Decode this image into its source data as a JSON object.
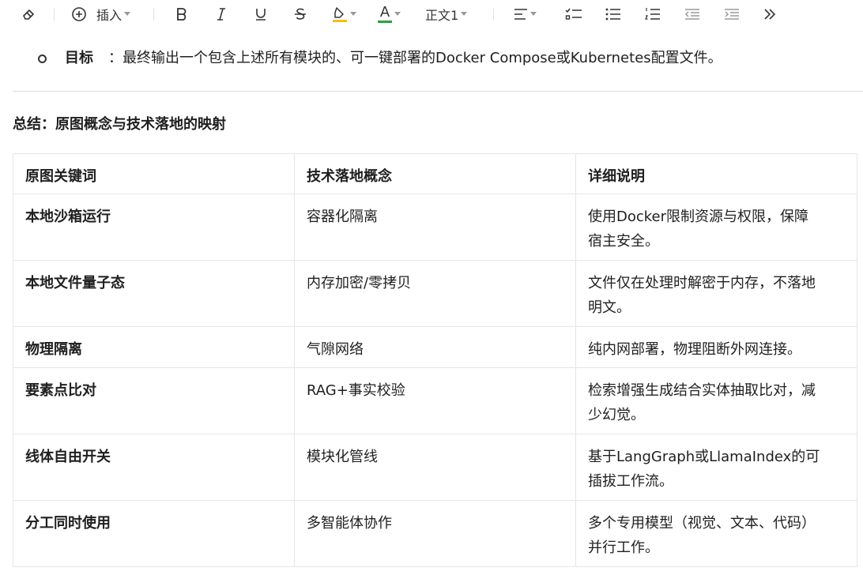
{
  "toolbar": {
    "insert_label": "插入",
    "style_label": "正文1",
    "text_color_letter": "A",
    "accent_highlight": "#f2c200",
    "accent_text_color": "#2f9e44",
    "icons": [
      "eraser-icon",
      "plus-circle-icon",
      "bold-icon",
      "italic-icon",
      "underline-icon",
      "strikethrough-icon",
      "highlighter-icon",
      "text-color-icon",
      "align-left-icon",
      "checklist-icon",
      "bullet-list-icon",
      "numbered-list-icon",
      "outdent-icon",
      "indent-icon",
      "more-icon"
    ]
  },
  "goal": {
    "label": "目标",
    "text": "：最终输出一个包含上述所有模块的、可一键部署的Docker Compose或Kubernetes配置文件。"
  },
  "section_title": "总结：原图概念与技术落地的映射",
  "table": {
    "headers": [
      "原图关键词",
      "技术落地概念",
      "详细说明"
    ],
    "rows": [
      {
        "keyword": "本地沙箱运行",
        "concept": "容器化隔离",
        "detail_line1": "使用Docker限制资源与权限，保障",
        "detail_line2": "宿主安全。"
      },
      {
        "keyword": "本地文件量子态",
        "concept": "内存加密/零拷贝",
        "detail_line1": "文件仅在处理时解密于内存，不落地",
        "detail_line2": "明文。"
      },
      {
        "keyword": "物理隔离",
        "concept": "气隙网络",
        "detail_line1": "纯内网部署，物理阻断外网连接。",
        "detail_line2": ""
      },
      {
        "keyword": "要素点比对",
        "concept": "RAG+事实校验",
        "detail_line1": "检索增强生成结合实体抽取比对，减",
        "detail_line2": "少幻觉。"
      },
      {
        "keyword": "线体自由开关",
        "concept": "模块化管线",
        "detail_line1": "基于LangGraph或LlamaIndex的可",
        "detail_line2": "插拔工作流。"
      },
      {
        "keyword": "分工同时使用",
        "concept": "多智能体协作",
        "detail_line1": "多个专用模型（视觉、文本、代码）",
        "detail_line2": "并行工作。"
      }
    ]
  }
}
